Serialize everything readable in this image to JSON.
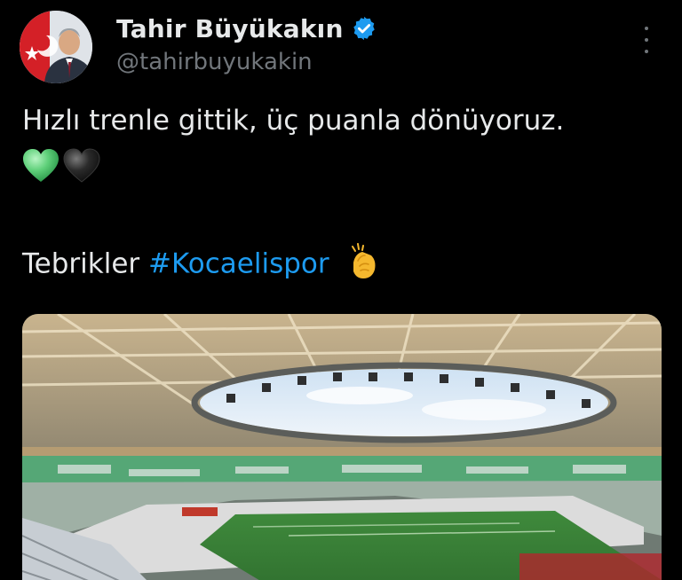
{
  "tweet": {
    "display_name": "Tahir Büyükakın",
    "handle": "@tahirbuyukakin",
    "text_line1": "Hızlı trenle gittik, üç puanla dönüyoruz.",
    "hearts": [
      "green-heart-icon",
      "black-heart-icon"
    ],
    "text_prefix": "Tebrikler",
    "hashtag": "#Kocaelispor",
    "emoji": "clapping-hands-icon"
  },
  "colors": {
    "background": "#000000",
    "text": "#e7e9ea",
    "muted": "#71767b",
    "link": "#1d9bf0",
    "verified": "#1d9bf0"
  }
}
